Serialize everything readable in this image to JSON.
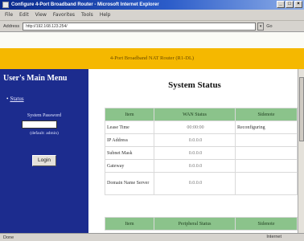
{
  "window": {
    "title": "Configure 4-Port Broadband Router - Microsoft Internet Explorer",
    "buttons": [
      "_",
      "□",
      "×"
    ]
  },
  "menubar": {
    "items": [
      "File",
      "Edit",
      "View",
      "Favorites",
      "Tools",
      "Help"
    ]
  },
  "address": {
    "label": "Address",
    "url": "http://192.168.123.254/",
    "go_label": "Go"
  },
  "banner": {
    "text": "4-Port Broadband NAT Router (R1-DL)"
  },
  "sidebar": {
    "title": "User's Main Menu",
    "status_link": "Status",
    "password_label": "System Password",
    "password_value": "",
    "default_text": "(default: admin)",
    "login_label": "Login"
  },
  "content": {
    "title": "System Status",
    "table_headers": [
      "Item",
      "WAN Status",
      "Sidenote"
    ],
    "rows": [
      {
        "item": "Lease Time",
        "value": "00:00:00",
        "note": "Reconfiguring"
      },
      {
        "item": "IP Address",
        "value": "0.0.0.0",
        "note": ""
      },
      {
        "item": "Subnet Mask",
        "value": "0.0.0.0",
        "note": ""
      },
      {
        "item": "Gateway",
        "value": "0.0.0.0",
        "note": ""
      },
      {
        "item": "Domain Name Server",
        "value": "0.0.0.0",
        "note": ""
      }
    ],
    "peripheral_headers": [
      "Item",
      "Peripheral Status",
      "Sidenote"
    ]
  },
  "statusbar": {
    "left": "Done",
    "zone": "Internet"
  },
  "colors": {
    "banner": "#f5b800",
    "sidebar": "#1c2c8e",
    "table_header": "#8bc38b"
  }
}
